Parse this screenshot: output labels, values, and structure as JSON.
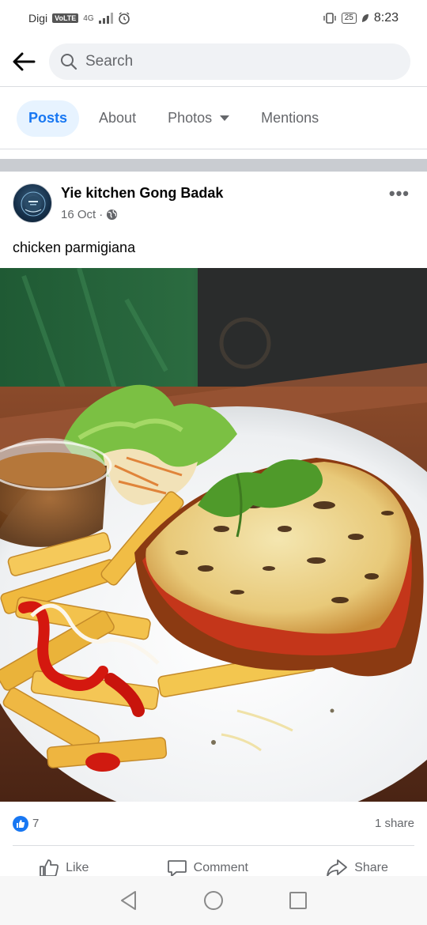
{
  "status_bar": {
    "carrier": "Digi",
    "volte": "VoLTE",
    "network": "4G",
    "battery": "25",
    "time": "8:23"
  },
  "search": {
    "placeholder": "Search"
  },
  "tabs": [
    {
      "label": "Posts",
      "active": true
    },
    {
      "label": "About",
      "active": false
    },
    {
      "label": "Photos",
      "active": false
    },
    {
      "label": "Mentions",
      "active": false
    }
  ],
  "post": {
    "page_name": "Yie kitchen Gong Badak",
    "date": "16 Oct",
    "date_separator": "·",
    "caption": "chicken parmigiana",
    "like_count": "7",
    "share_count": "1 share"
  },
  "actions": {
    "like": "Like",
    "comment": "Comment",
    "share": "Share"
  },
  "colors": {
    "accent": "#1877f2",
    "muted_text": "#65676b",
    "separator": "#c9ccd1"
  }
}
